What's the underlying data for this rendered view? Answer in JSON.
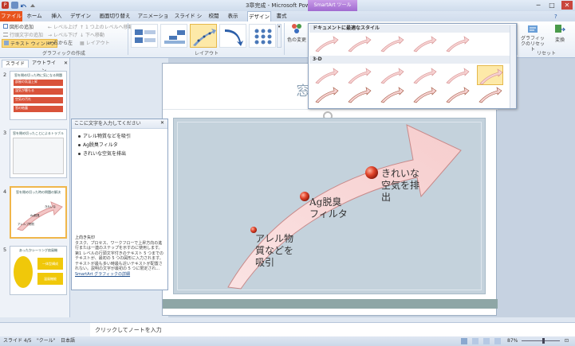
{
  "window": {
    "title": "3章完成 - Microsoft PowerPoint",
    "context_tool": "SmartArt ツール",
    "controls": [
      "─",
      "□",
      "✕"
    ]
  },
  "tabs": [
    "ファイル",
    "ホーム",
    "挿入",
    "デザイン",
    "画面切り替え",
    "アニメーション",
    "スライド ショー",
    "校閲",
    "表示",
    "デザイン",
    "書式"
  ],
  "ribbon": {
    "create_graphic": {
      "add_shape": "図形の追加",
      "add_bullet": "行頭文字の追加",
      "text_pane": "テキスト ウィンドウ",
      "promote": "レベル上げ",
      "demote": "レベル下げ",
      "right_to_left": "右から左",
      "move_up": "1 つ上のレベルへ移動",
      "move_down": "下へ移動",
      "layout": "レイアウト",
      "group": "グラフィックの作成"
    },
    "layouts_group": "レイアウト",
    "change_colors": "色の変更",
    "reset_graphic": "グラフィックのリセット",
    "convert": "変換",
    "reset_group": "リセット"
  },
  "gallery": {
    "section1": "ドキュメントに最適なスタイル",
    "section2": "3-D"
  },
  "panel_tabs": [
    "スライド",
    "アウトライン"
  ],
  "slide_numbers": [
    "2",
    "3",
    "4",
    "5"
  ],
  "thumbs": {
    "t2_title": "窓を閉め切った時に気になる問題",
    "t2_items": [
      "部屋の気温上昇",
      "湿気が籠もる",
      "空気の汚れ",
      "窓の結露"
    ],
    "t3_title": "窓を閉め切ったことによるトラブル",
    "t4_title": "窓を閉め切った時の問題の解決",
    "t4_labels": [
      "アレルプ物質",
      "Ag脱臭",
      "きれいな"
    ],
    "t5_title": "あったかシーリング扇風機",
    "t5_items": [
      "一体型構成",
      "温風機能"
    ]
  },
  "text_pane": {
    "header": "ここに文字を入力してください",
    "items": [
      "アレル物質などを吸引",
      "Ag脱臭フィルタ",
      "きれいな空気を排出"
    ],
    "desc_title": "上向き矢印",
    "desc": "タスク、プロセス、ワークフローで上昇方向の進行または一連のステップを示すのに使用します。第1 レベルの行頭文字付きのテキスト 5 つまでのテキストが、最初の 5 つの図形に入力されます。テキストが最も多い時最も近いテキストが配置されない。説明の文字が最初の 5 つに限定され...",
    "link": "SmartArt グラフィックの詳細"
  },
  "slide": {
    "title": "窓を閉め切",
    "labels": {
      "l1": [
        "アレル物",
        "質などを",
        "吸引"
      ],
      "l2": [
        "Ag脱臭",
        "フィルタ"
      ],
      "l3": [
        "きれいな",
        "空気を排",
        "出"
      ]
    }
  },
  "notes": "クリックしてノートを入力",
  "status": {
    "slide": "スライド 4/5",
    "theme": "\"クール\"",
    "lang": "日本語",
    "zoom": "87%"
  }
}
